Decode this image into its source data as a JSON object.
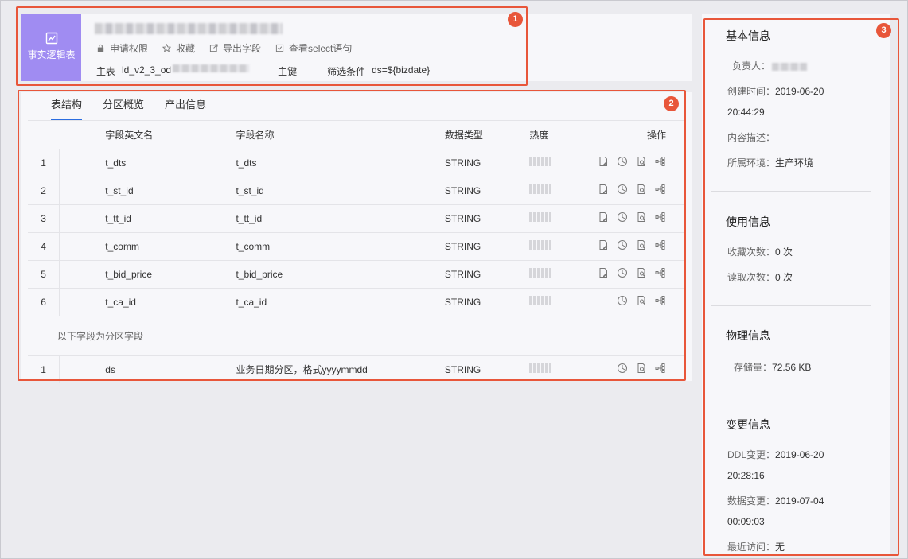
{
  "header": {
    "logo_label": "事实逻辑表",
    "actions": [
      "申请权限",
      "收藏",
      "导出字段",
      "查看select语句"
    ],
    "main_table_label": "主表",
    "main_table_value": "ld_v2_3_od",
    "primary_key_label": "主键",
    "filter_label": "筛选条件",
    "filter_value": "ds=${bizdate}"
  },
  "tabs": [
    "表结构",
    "分区概览",
    "产出信息"
  ],
  "table": {
    "columns": [
      "字段英文名",
      "字段名称",
      "数据类型",
      "热度",
      "操作"
    ],
    "rows": [
      {
        "idx": "1",
        "en": "t_dts",
        "name": "t_dts",
        "type": "STRING"
      },
      {
        "idx": "2",
        "en": "t_st_id",
        "name": "t_st_id",
        "type": "STRING"
      },
      {
        "idx": "3",
        "en": "t_tt_id",
        "name": "t_tt_id",
        "type": "STRING"
      },
      {
        "idx": "4",
        "en": "t_comm",
        "name": "t_comm",
        "type": "STRING"
      },
      {
        "idx": "5",
        "en": "t_bid_price",
        "name": "t_bid_price",
        "type": "STRING"
      },
      {
        "idx": "6",
        "en": "t_ca_id",
        "name": "t_ca_id",
        "type": "STRING"
      }
    ],
    "partition_label": "以下字段为分区字段",
    "partition_rows": [
      {
        "idx": "1",
        "en": "ds",
        "name": "业务日期分区，格式yyyymmdd",
        "type": "STRING"
      }
    ]
  },
  "side": {
    "basic_title": "基本信息",
    "owner_label": "负责人：",
    "created_label": "创建时间：",
    "created_value": "2019-06-20 20:44:29",
    "desc_label": "内容描述：",
    "env_label": "所属环境：",
    "env_value": "生产环境",
    "usage_title": "使用信息",
    "fav_label": "收藏次数：",
    "fav_value": "0 次",
    "read_label": "读取次数：",
    "read_value": "0 次",
    "phys_title": "物理信息",
    "storage_label": "存储量：",
    "storage_value": "72.56 KB",
    "change_title": "变更信息",
    "ddl_label": "DDL变更：",
    "ddl_value": "2019-06-20 20:28:16",
    "data_change_label": "数据变更：",
    "data_change_value": "2019-07-04 00:09:03",
    "last_visit_label": "最近访问：",
    "last_visit_value": "无"
  },
  "badges": [
    "1",
    "2",
    "3"
  ],
  "icons": {
    "logo": "line-chart-icon",
    "actions": [
      "lock-icon",
      "star-icon",
      "export-icon",
      "checkbox-icon"
    ],
    "ops": [
      "edit-doc-icon",
      "compass-icon",
      "search-doc-icon",
      "lineage-icon"
    ]
  },
  "colors": {
    "accent": "#2b6de0",
    "logo_bg": "#a08cf2",
    "annotation": "#e8563a"
  }
}
